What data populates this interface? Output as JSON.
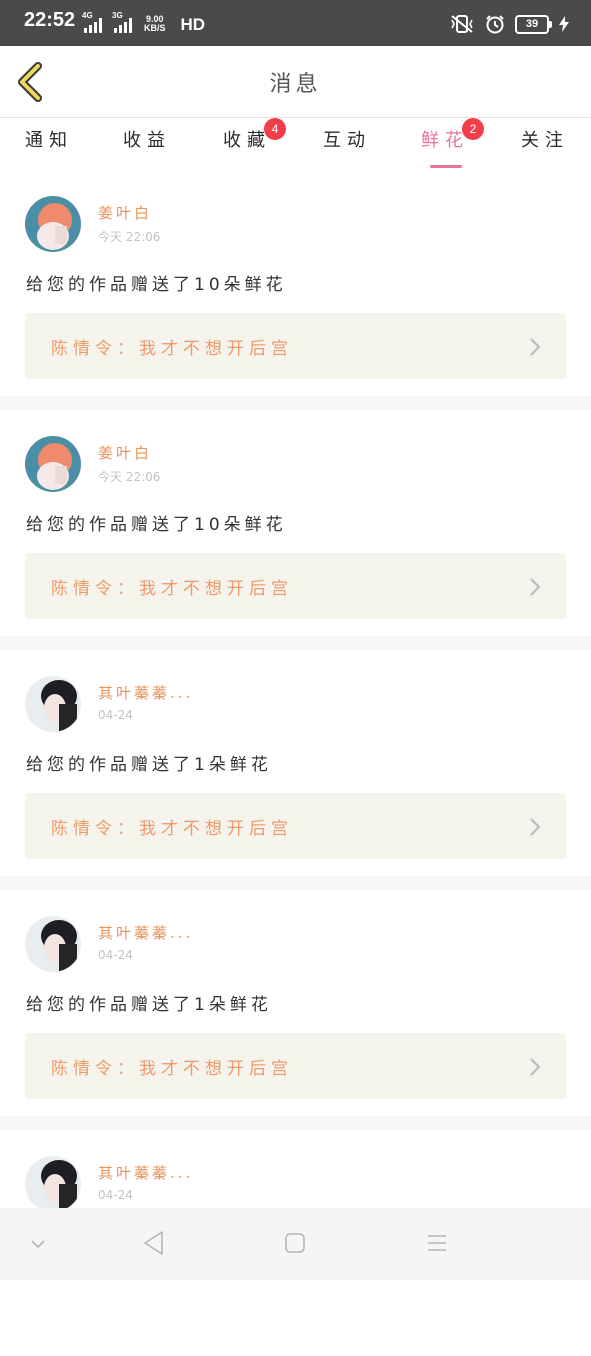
{
  "status_bar": {
    "time": "22:52",
    "network": "4G",
    "network2": "3G",
    "speed_value": "9.00",
    "speed_unit": "KB/S",
    "hd": "HD",
    "battery": "39"
  },
  "header": {
    "title": "消息"
  },
  "tabs": [
    {
      "label": "通知",
      "badge": ""
    },
    {
      "label": "收益",
      "badge": ""
    },
    {
      "label": "收藏",
      "badge": "4"
    },
    {
      "label": "互动",
      "badge": ""
    },
    {
      "label": "鲜花",
      "badge": "2",
      "active": true
    },
    {
      "label": "关注",
      "badge": ""
    }
  ],
  "items": [
    {
      "username": "姜叶白",
      "time": "今天 22:06",
      "message": "给您的作品赠送了10朵鲜花",
      "work": "陈情令：我才不想开后宫"
    },
    {
      "username": "姜叶白",
      "time": "今天 22:06",
      "message": "给您的作品赠送了10朵鲜花",
      "work": "陈情令：我才不想开后宫"
    },
    {
      "username": "其叶蓁蓁...",
      "time": "04-24",
      "message": "给您的作品赠送了1朵鲜花",
      "work": "陈情令：我才不想开后宫"
    },
    {
      "username": "其叶蓁蓁...",
      "time": "04-24",
      "message": "给您的作品赠送了1朵鲜花",
      "work": "陈情令：我才不想开后宫"
    },
    {
      "username": "其叶蓁蓁...",
      "time": "04-24",
      "message": "",
      "work": ""
    }
  ],
  "colors": {
    "accent": "#e97399",
    "username": "#e8935e",
    "work_text": "#ef9a68",
    "badge": "#f23e4a",
    "quote_bg": "#f4f4ec"
  },
  "icons": {
    "back": "chevron-left-icon",
    "quote": "chevron-right-icon",
    "nav": [
      "chevron-down-icon",
      "back-triangle-icon",
      "home-square-icon",
      "menu-icon"
    ]
  }
}
